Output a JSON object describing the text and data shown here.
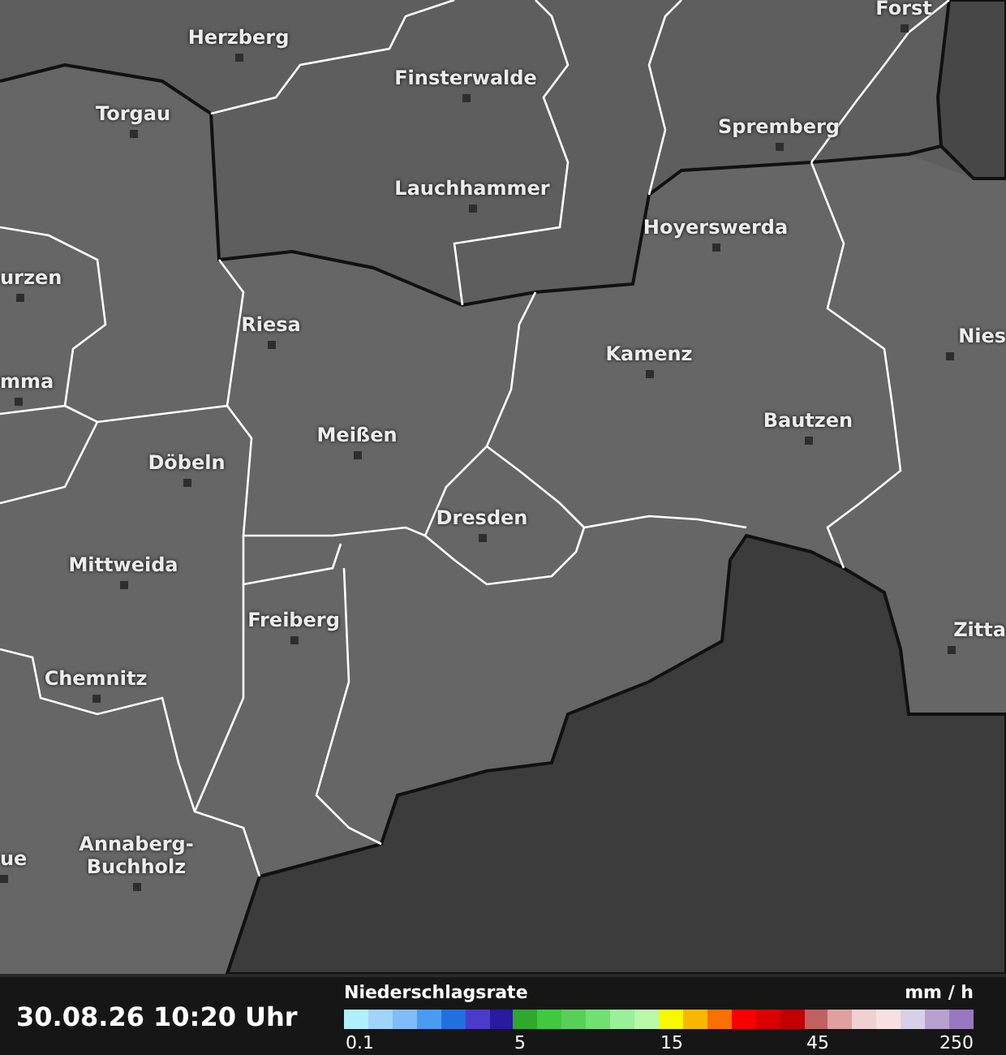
{
  "map": {
    "places": [
      {
        "name": "Forst"
      },
      {
        "name": "Herzberg"
      },
      {
        "name": "Finsterwalde"
      },
      {
        "name": "Torgau"
      },
      {
        "name": "Spremberg"
      },
      {
        "name": "Lauchhammer"
      },
      {
        "name": "Hoyerswerda"
      },
      {
        "name": "urzen"
      },
      {
        "name": "Riesa"
      },
      {
        "name": "Kamenz"
      },
      {
        "name": "Nies"
      },
      {
        "name": "mma"
      },
      {
        "name": "Meißen"
      },
      {
        "name": "Bautzen"
      },
      {
        "name": "Döbeln"
      },
      {
        "name": "Dresden"
      },
      {
        "name": "Mittweida"
      },
      {
        "name": "Freiberg"
      },
      {
        "name": "Zitta"
      },
      {
        "name": "Chemnitz"
      },
      {
        "name": "ue"
      },
      {
        "name": "Annaberg-\nBuchholz"
      }
    ]
  },
  "timestamp": "30.08.26 10:20 Uhr",
  "legend": {
    "title": "Niederschlagsrate",
    "unit": "mm / h",
    "swatches": [
      {
        "color": "#b0f0fc"
      },
      {
        "color": "#a0d4fa"
      },
      {
        "color": "#80bcf8"
      },
      {
        "color": "#4a9cf0"
      },
      {
        "color": "#2070e0"
      },
      {
        "color": "#4a3cc8"
      },
      {
        "color": "#2a1aa0"
      },
      {
        "color": "#30a830"
      },
      {
        "color": "#40c840"
      },
      {
        "color": "#58d058"
      },
      {
        "color": "#70e070"
      },
      {
        "color": "#98f098"
      },
      {
        "color": "#b8f8a8"
      },
      {
        "color": "#f8f800"
      },
      {
        "color": "#f8b800"
      },
      {
        "color": "#f87000"
      },
      {
        "color": "#f80000"
      },
      {
        "color": "#d80000"
      },
      {
        "color": "#c00000"
      },
      {
        "color": "#c06060"
      },
      {
        "color": "#e0a0a0"
      },
      {
        "color": "#f0d0d0"
      },
      {
        "color": "#f8e0e0"
      },
      {
        "color": "#d8d0e8"
      },
      {
        "color": "#b8a0d0"
      },
      {
        "color": "#9878c0"
      }
    ],
    "ticks": [
      "0.1",
      "5",
      "15",
      "45",
      "250"
    ]
  }
}
